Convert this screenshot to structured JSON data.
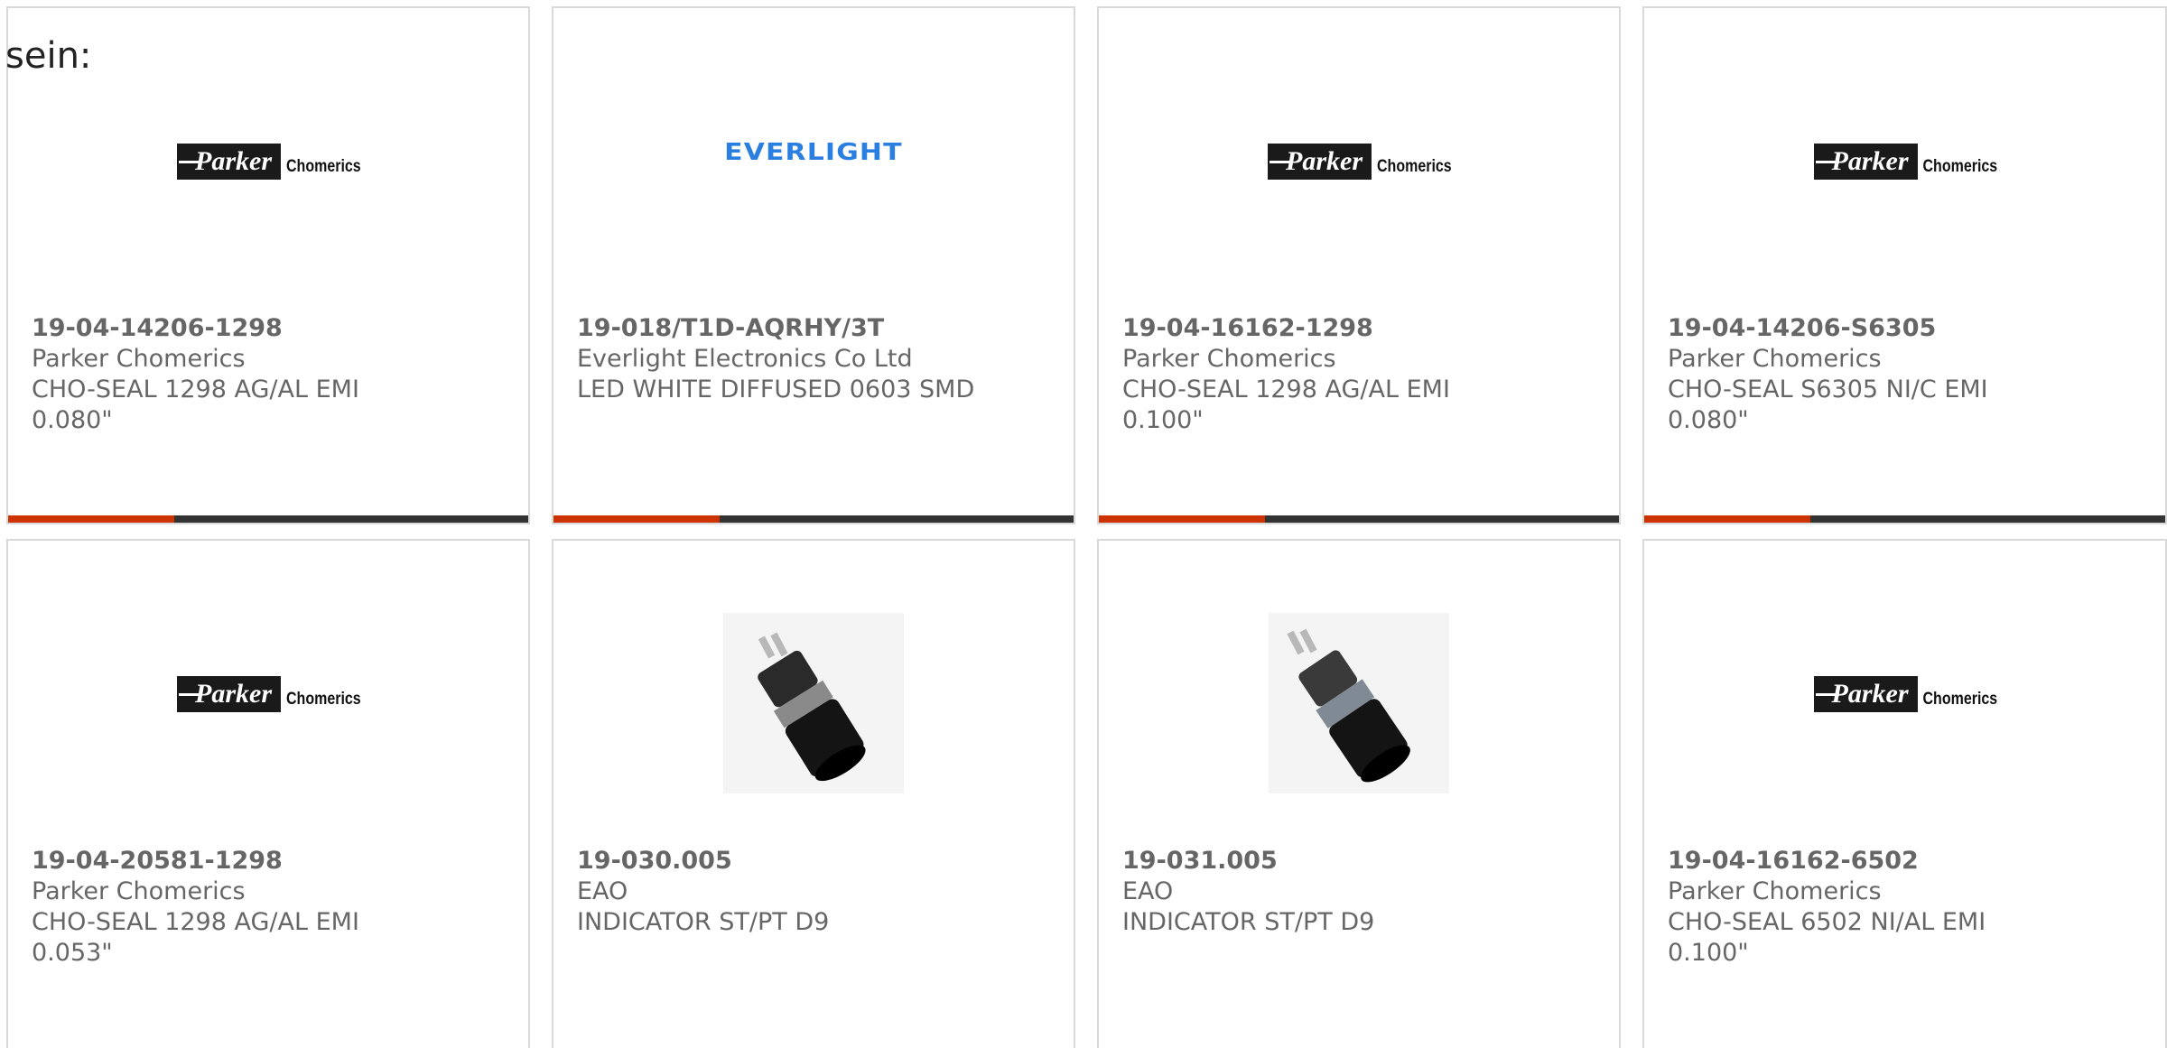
{
  "intro_text": "sein:",
  "colors": {
    "accent": "#cc3300",
    "bar": "#333333",
    "text": "#666666",
    "border": "#d9d9d9",
    "everlight_blue": "#2b7fe0"
  },
  "products": [
    {
      "part_number": "19-04-14206-1298",
      "manufacturer": "Parker Chomerics",
      "description_line1": "CHO-SEAL 1298 AG/AL EMI",
      "description_line2": "0.080\"",
      "image": "parker-chomerics-logo",
      "logo_mark": "Parker",
      "logo_sub": "Chomerics"
    },
    {
      "part_number": "19-018/T1D-AQRHY/3T",
      "manufacturer": "Everlight Electronics Co Ltd",
      "description_line1": "LED WHITE DIFFUSED 0603 SMD",
      "description_line2": "",
      "image": "everlight-logo",
      "logo_mark": "EVERLIGHT",
      "logo_sub": ""
    },
    {
      "part_number": "19-04-16162-1298",
      "manufacturer": "Parker Chomerics",
      "description_line1": "CHO-SEAL 1298 AG/AL EMI",
      "description_line2": "0.100\"",
      "image": "parker-chomerics-logo",
      "logo_mark": "Parker",
      "logo_sub": "Chomerics"
    },
    {
      "part_number": "19-04-14206-S6305",
      "manufacturer": "Parker Chomerics",
      "description_line1": "CHO-SEAL S6305 NI/C EMI",
      "description_line2": "0.080\"",
      "image": "parker-chomerics-logo",
      "logo_mark": "Parker",
      "logo_sub": "Chomerics"
    },
    {
      "part_number": "19-04-20581-1298",
      "manufacturer": "Parker Chomerics",
      "description_line1": "CHO-SEAL 1298 AG/AL EMI",
      "description_line2": "0.053\"",
      "image": "parker-chomerics-logo",
      "logo_mark": "Parker",
      "logo_sub": "Chomerics"
    },
    {
      "part_number": "19-030.005",
      "manufacturer": "EAO",
      "description_line1": "INDICATOR ST/PT D9",
      "description_line2": "",
      "image": "indicator-photo"
    },
    {
      "part_number": "19-031.005",
      "manufacturer": "EAO",
      "description_line1": "INDICATOR ST/PT D9",
      "description_line2": "",
      "image": "indicator-photo"
    },
    {
      "part_number": "19-04-16162-6502",
      "manufacturer": "Parker Chomerics",
      "description_line1": "CHO-SEAL 6502 NI/AL EMI",
      "description_line2": "0.100\"",
      "image": "parker-chomerics-logo",
      "logo_mark": "Parker",
      "logo_sub": "Chomerics"
    }
  ]
}
